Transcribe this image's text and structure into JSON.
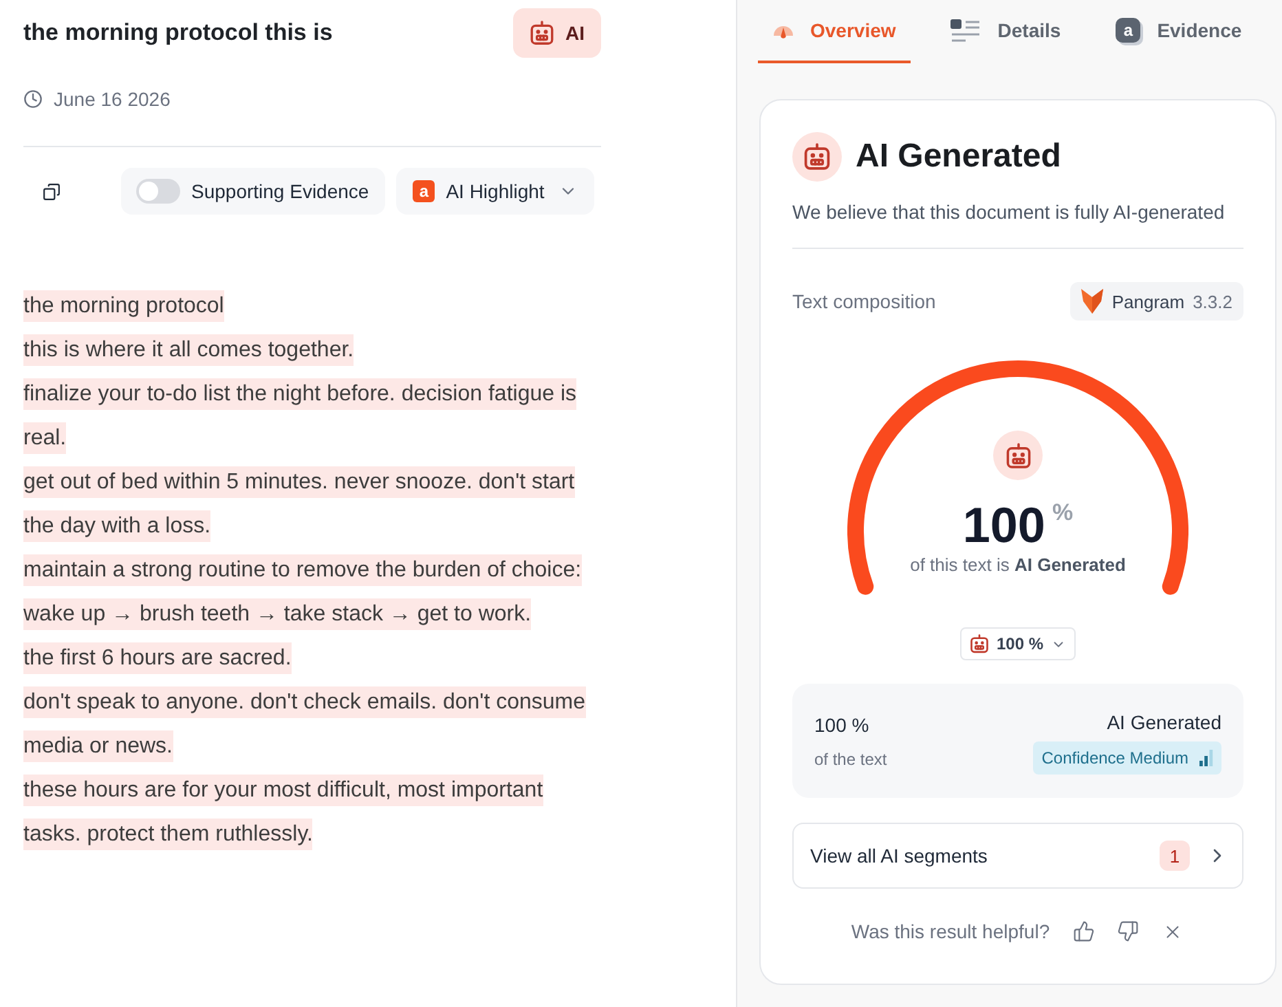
{
  "document": {
    "title": "the morning protocol this is",
    "label_badge": {
      "text": "AI"
    },
    "date": "June 16 2026"
  },
  "toolbar": {
    "supporting_evidence": {
      "label": "Supporting Evidence",
      "on": false
    },
    "highlight_menu": {
      "icon_letter": "a",
      "label": "AI Highlight"
    }
  },
  "segments": [
    {
      "text": "the morning protocol",
      "highlighted": true
    },
    {
      "text": "this is where it all comes together.",
      "highlighted": true
    },
    {
      "text": "finalize your to-do list the night before. decision fatigue is real.",
      "highlighted": true
    },
    {
      "text": "get out of bed within 5 minutes. never snooze. don't start the day with a loss.",
      "highlighted": true
    },
    {
      "text": "maintain a strong routine to remove the burden of choice:",
      "highlighted": true
    },
    {
      "text": "wake up → brush teeth → take stack → get to work.",
      "highlighted": true
    },
    {
      "text": "the first 6 hours are sacred.",
      "highlighted": true
    },
    {
      "text": "don't speak to anyone. don't check emails. don't consume media or news.",
      "highlighted": true
    },
    {
      "text": "these hours are for your most difficult, most important tasks. protect them ruthlessly.",
      "highlighted": true
    }
  ],
  "tabs": [
    {
      "label": "Overview",
      "selected": true,
      "kind": "gauge"
    },
    {
      "label": "Details",
      "selected": false,
      "kind": "list"
    },
    {
      "label": "Evidence",
      "selected": false,
      "kind": "letter",
      "icon_letter": "a"
    }
  ],
  "result": {
    "title": "AI Generated",
    "description": "We believe that this document is fully AI-generated",
    "composition_label": "Text composition",
    "model": {
      "name": "Pangram",
      "version": "3.3.2"
    },
    "gauge": {
      "level": 1,
      "value": "100",
      "unit": "%",
      "caption": "of this text is **AI Generated**"
    },
    "filter": {
      "label": "100 %"
    },
    "summary": {
      "share": "100 %",
      "share_note": "of the text",
      "verdict": "AI Generated",
      "confidence": "Confidence Medium"
    },
    "segments_link": {
      "label": "View all AI segments",
      "count": "1"
    },
    "feedback": {
      "question": "Was this result helpful?"
    }
  }
}
